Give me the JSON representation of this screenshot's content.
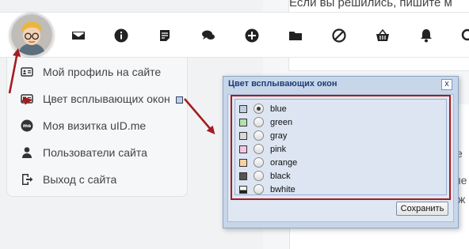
{
  "page": {
    "top_text": "Если вы решились, пишите м",
    "right_fragments": [
      "е",
      "пе",
      "ж"
    ]
  },
  "toolbar": {
    "icons": [
      "mail-icon",
      "info-icon",
      "notes-icon",
      "comments-icon",
      "add-icon",
      "folder-icon",
      "block-icon",
      "basket-icon",
      "bell-icon",
      "search-icon"
    ]
  },
  "menu": {
    "items": [
      {
        "label": "Мой профиль на сайте",
        "icon": "profile-card-icon"
      },
      {
        "label": "Цвет всплывающих окон",
        "icon": "color-window-icon"
      },
      {
        "label": "Моя визитка uID.me",
        "icon": "uid-me-icon"
      },
      {
        "label": "Пользователи сайта",
        "icon": "users-icon"
      },
      {
        "label": "Выход с сайта",
        "icon": "exit-icon"
      }
    ],
    "current_color_swatch": "#c2cfe0"
  },
  "dialog": {
    "title": "Цвет всплывающих окон",
    "close_label": "x",
    "save_label": "Сохранить",
    "selected": "blue",
    "options": [
      {
        "label": "blue",
        "color": "#c2cfe0"
      },
      {
        "label": "green",
        "color": "#b7e0b0"
      },
      {
        "label": "gray",
        "color": "#d9d9d9"
      },
      {
        "label": "pink",
        "color": "#f4c6e4"
      },
      {
        "label": "orange",
        "color": "#f7d2a4"
      },
      {
        "label": "black",
        "color": "#555555"
      },
      {
        "label": "bwhite",
        "color": "#ffffff"
      }
    ]
  },
  "colors": {
    "arrow": "#a41c22",
    "dialog_title": "#1c3c78"
  }
}
